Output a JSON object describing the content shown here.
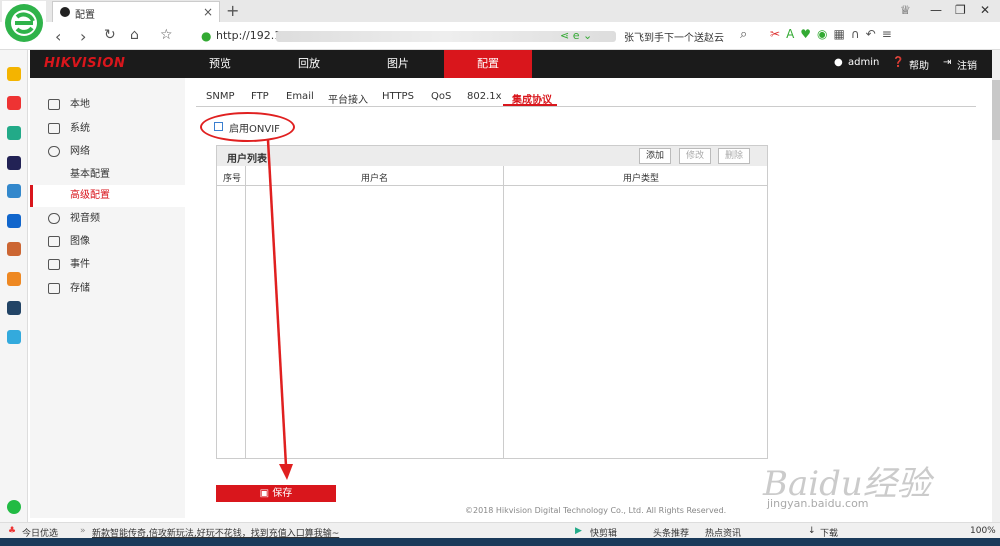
{
  "browser": {
    "tab_title": "配置",
    "url": "http://192.1",
    "search_suggestion": "张飞到手下一个送赵云"
  },
  "header": {
    "brand": "HIKVISION",
    "nav": [
      "预览",
      "回放",
      "图片",
      "配置"
    ],
    "user": "admin",
    "help": "帮助",
    "logout": "注销"
  },
  "sidebar": {
    "items": [
      "本地",
      "系统",
      "网络",
      "基本配置",
      "高级配置",
      "视音频",
      "图像",
      "事件",
      "存储"
    ]
  },
  "subtabs": [
    "SNMP",
    "FTP",
    "Email",
    "平台接入",
    "HTTPS",
    "QoS",
    "802.1x",
    "集成协议"
  ],
  "onvif": {
    "label": "启用ONVIF",
    "checked": false
  },
  "user_list": {
    "title": "用户列表",
    "add": "添加",
    "edit": "修改",
    "delete": "删除",
    "columns": [
      "序号",
      "用户名",
      "用户类型"
    ]
  },
  "save_label": "保存",
  "footer": "©2018 Hikvision Digital Technology Co., Ltd. All Rights Reserved.",
  "watermark": {
    "text": "Baidu经验",
    "sub": "jingyan.baidu.com"
  },
  "statusbar": {
    "left": "今日优选",
    "news": "新款智能传奇,倍攻新玩法,好玩不花钱，找到充值入口算我输~",
    "items": [
      "快剪辑",
      "头条推荐",
      "热点资讯",
      "下载"
    ],
    "zoom": "100%"
  },
  "colors": {
    "accent": "#d9161c",
    "header_bg": "#1b1b1b",
    "annotation": "#e02020"
  }
}
